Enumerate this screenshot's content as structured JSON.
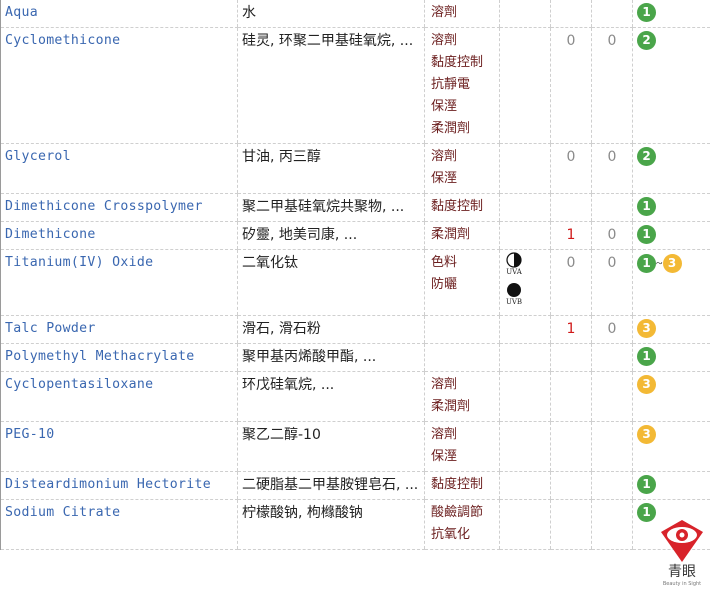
{
  "rows": [
    {
      "name": "Aqua",
      "cn": "水",
      "functions": [
        "溶劑"
      ],
      "uv": [],
      "n1": "",
      "n1_red": false,
      "n2": "",
      "safety": [
        {
          "v": "1",
          "color": "green"
        }
      ]
    },
    {
      "name": "Cyclomethicone",
      "cn": "硅灵, 环聚二甲基硅氧烷, ...",
      "functions": [
        "溶劑",
        "黏度控制",
        "抗靜電",
        "保溼",
        "柔潤劑"
      ],
      "uv": [],
      "n1": "0",
      "n1_red": false,
      "n2": "0",
      "safety": [
        {
          "v": "2",
          "color": "green"
        }
      ]
    },
    {
      "name": "Glycerol",
      "cn": "甘油, 丙三醇",
      "functions": [
        "溶劑",
        "保溼"
      ],
      "uv": [],
      "n1": "0",
      "n1_red": false,
      "n2": "0",
      "safety": [
        {
          "v": "2",
          "color": "green"
        }
      ]
    },
    {
      "name": "Dimethicone Crosspolymer",
      "cn": "聚二甲基硅氧烷共聚物, ...",
      "functions": [
        "黏度控制"
      ],
      "uv": [],
      "n1": "",
      "n1_red": false,
      "n2": "",
      "safety": [
        {
          "v": "1",
          "color": "green"
        }
      ]
    },
    {
      "name": "Dimethicone",
      "cn": "矽靈, 地美司康, ...",
      "functions": [
        "柔潤劑"
      ],
      "uv": [],
      "n1": "1",
      "n1_red": true,
      "n2": "0",
      "safety": [
        {
          "v": "1",
          "color": "green"
        }
      ]
    },
    {
      "name": "Titanium(IV) Oxide",
      "cn": "二氧化钛",
      "functions": [
        "色料",
        "防曬"
      ],
      "uv": [
        {
          "label": "UVA",
          "icon": "half-circle-icon"
        },
        {
          "label": "UVB",
          "icon": "full-circle-icon"
        }
      ],
      "n1": "0",
      "n1_red": false,
      "n2": "0",
      "safety": [
        {
          "v": "1",
          "color": "green"
        },
        {
          "v": "3",
          "color": "yellow"
        }
      ],
      "safety_sep": "~"
    },
    {
      "name": "Talc Powder",
      "cn": "滑石, 滑石粉",
      "functions": [],
      "uv": [],
      "n1": "1",
      "n1_red": true,
      "n2": "0",
      "safety": [
        {
          "v": "3",
          "color": "yellow"
        }
      ]
    },
    {
      "name": "Polymethyl Methacrylate",
      "cn": "聚甲基丙烯酸甲酯, ...",
      "functions": [],
      "uv": [],
      "n1": "",
      "n1_red": false,
      "n2": "",
      "safety": [
        {
          "v": "1",
          "color": "green"
        }
      ]
    },
    {
      "name": "Cyclopentasiloxane",
      "cn": "环戊硅氧烷, ...",
      "functions": [
        "溶劑",
        "柔潤劑"
      ],
      "uv": [],
      "n1": "",
      "n1_red": false,
      "n2": "",
      "safety": [
        {
          "v": "3",
          "color": "yellow"
        }
      ]
    },
    {
      "name": "PEG-10",
      "cn": "聚乙二醇-10",
      "functions": [
        "溶劑",
        "保溼"
      ],
      "uv": [],
      "n1": "",
      "n1_red": false,
      "n2": "",
      "safety": [
        {
          "v": "3",
          "color": "yellow"
        }
      ]
    },
    {
      "name": "Disteardimonium Hectorite",
      "cn": "二硬脂基二甲基胺锂皂石, ...",
      "functions": [
        "黏度控制"
      ],
      "uv": [],
      "n1": "",
      "n1_red": false,
      "n2": "",
      "safety": [
        {
          "v": "1",
          "color": "green"
        }
      ]
    },
    {
      "name": "Sodium Citrate",
      "cn": "柠檬酸钠, 枸橼酸钠",
      "functions": [
        "酸鹼調節",
        "抗氧化"
      ],
      "uv": [],
      "n1": "",
      "n1_red": false,
      "n2": "",
      "safety": [
        {
          "v": "1",
          "color": "green"
        }
      ]
    }
  ],
  "logo": {
    "brand": "青眼",
    "tagline": "Beauty in Sight"
  },
  "colors": {
    "link": "#3a67b0",
    "function_text": "#6b1e1e",
    "badge_green": "#4aa54a",
    "badge_yellow": "#f3b935",
    "irritant_red": "#d01818",
    "logo_red": "#d8232a"
  }
}
